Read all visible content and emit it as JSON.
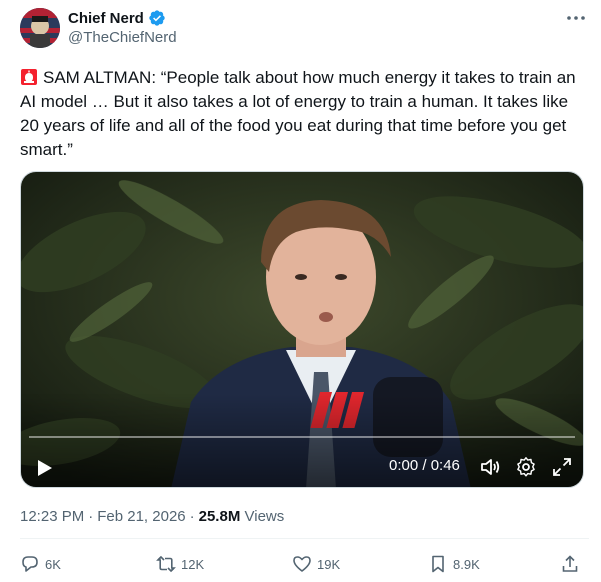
{
  "author": {
    "display_name": "Chief Nerd",
    "handle": "@TheChiefNerd",
    "verified": true,
    "verified_color": "#1d9bf0"
  },
  "tweet": {
    "emoji": "siren-icon",
    "text": "SAM ALTMAN: “People talk about how much energy it takes to train an AI model … But it also takes a lot of energy to train a human. It takes like 20 years of life and all of the food you eat during that time before you get smart.”"
  },
  "video": {
    "current_time": "0:00",
    "duration": "0:46",
    "time_display": "0:00 / 0:46",
    "progress": 0.0,
    "icons": [
      "play-icon",
      "volume-icon",
      "settings-icon",
      "fullscreen-icon"
    ]
  },
  "meta": {
    "time": "12:23 PM",
    "date": "Feb 21, 2026",
    "views_count": "25.8M",
    "views_label": "Views"
  },
  "actions": {
    "replies": "6K",
    "reposts": "12K",
    "likes": "19K",
    "bookmarks": "8.9K"
  },
  "colors": {
    "text": "#0f1419",
    "secondary": "#536471",
    "accent": "#1d9bf0",
    "divider": "#eff3f4"
  }
}
